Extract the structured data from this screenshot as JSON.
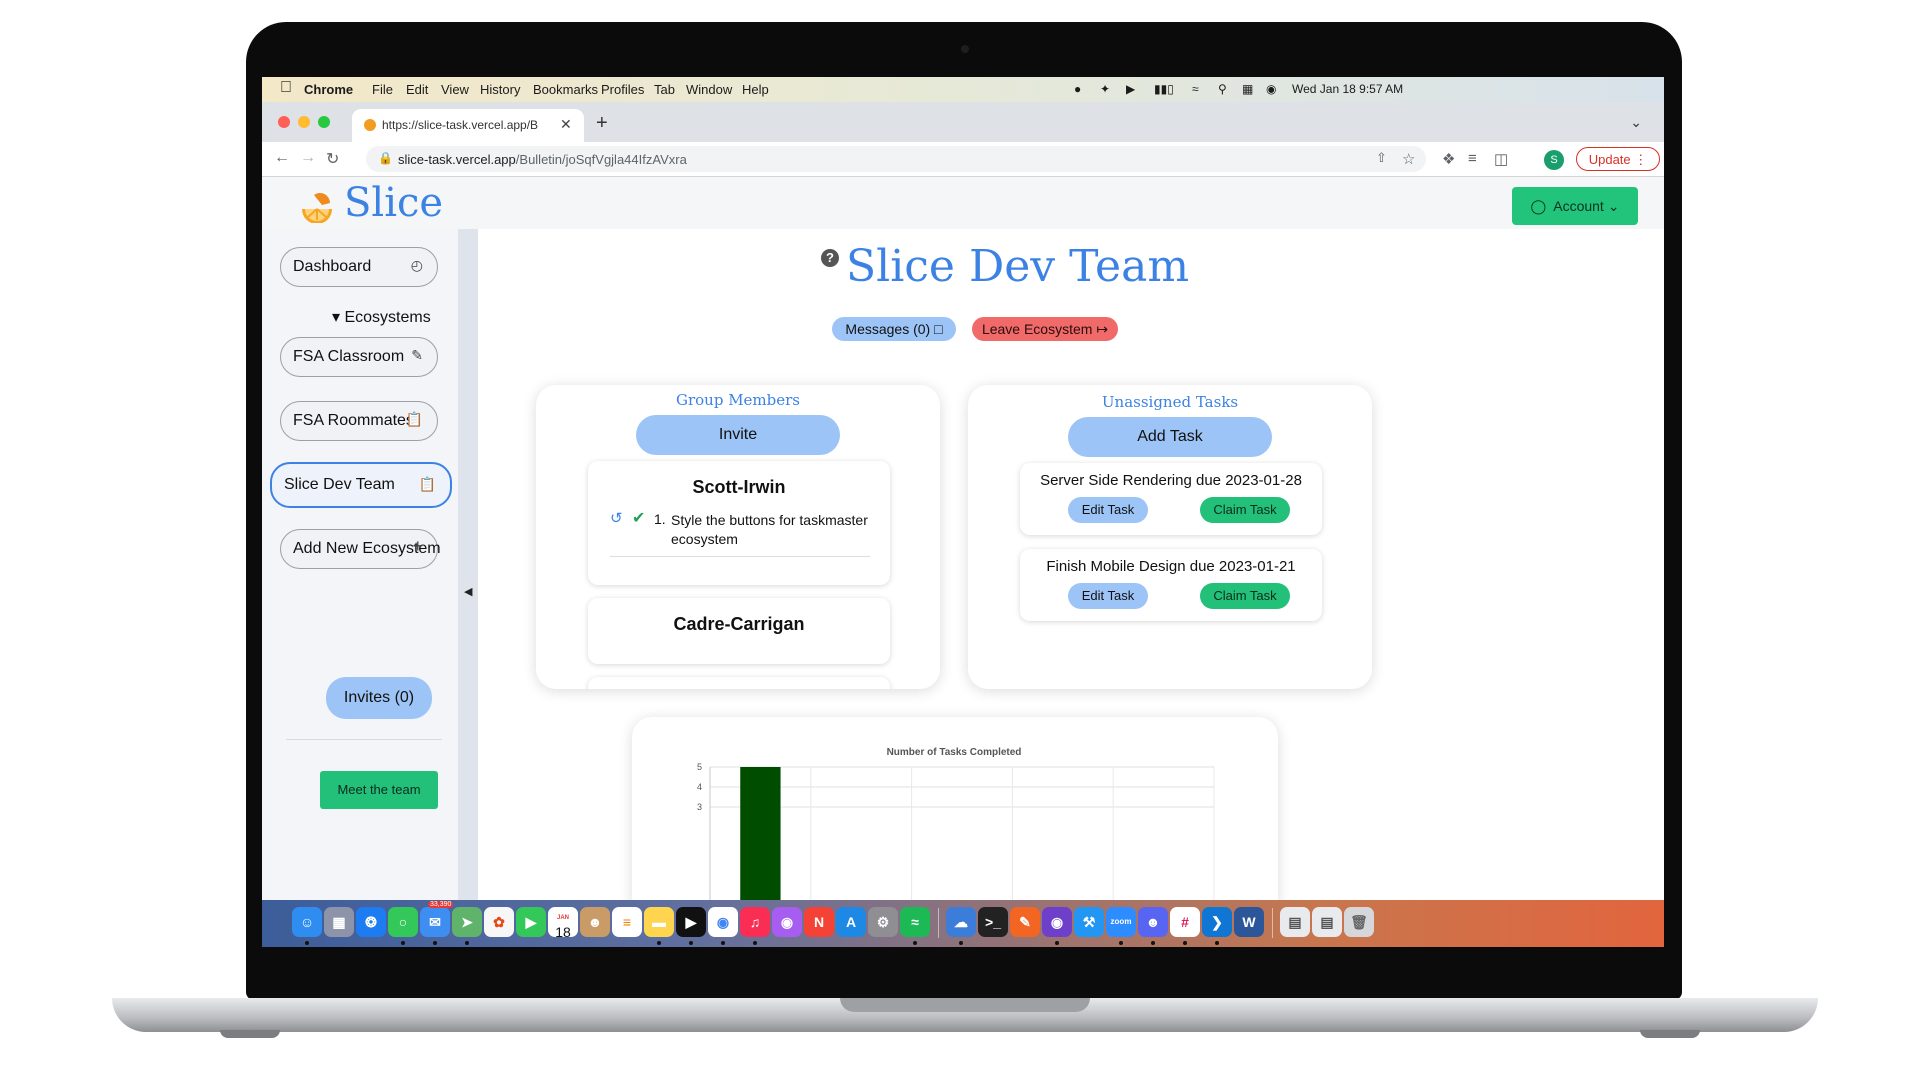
{
  "menubar": {
    "app": "Chrome",
    "menus": [
      "File",
      "Edit",
      "View",
      "History",
      "Bookmarks",
      "Profiles",
      "Tab",
      "Window",
      "Help"
    ],
    "clock": "Wed Jan 18  9:57 AM"
  },
  "browser": {
    "tab_title": "https://slice-task.vercel.app/B",
    "url_domain": "slice-task.vercel.app",
    "url_path": "/Bulletin/joSqfVgjla44IfzAVxra",
    "profile_initial": "S",
    "update_label": "Update"
  },
  "header": {
    "brand": "Slice",
    "account_label": "Account"
  },
  "sidebar": {
    "dashboard": "Dashboard",
    "ecosystems_label": "Ecosystems",
    "ecosystems": [
      "FSA Classroom",
      "FSA Roommates",
      "Slice Dev Team"
    ],
    "active_ecosystem": "Slice Dev Team",
    "add_ecosystem": "Add New Ecosystem",
    "invites": "Invites (0)",
    "meet_team": "Meet the team"
  },
  "main": {
    "title": "Slice Dev Team",
    "messages_label": "Messages (0)",
    "leave_label": "Leave Ecosystem",
    "group_members": {
      "title": "Group Members",
      "invite_label": "Invite",
      "members": [
        {
          "name": "Scott-Irwin",
          "tasks": [
            {
              "num": "1.",
              "text": "Style the buttons for taskmaster ecosystem"
            }
          ]
        },
        {
          "name": "Cadre-Carrigan",
          "tasks": []
        }
      ]
    },
    "unassigned_tasks": {
      "title": "Unassigned Tasks",
      "add_label": "Add Task",
      "edit_label": "Edit Task",
      "claim_label": "Claim Task",
      "tasks": [
        {
          "title": "Server Side Rendering due 2023-01-28"
        },
        {
          "title": "Finish Mobile Design due 2023-01-21"
        }
      ]
    }
  },
  "chart_data": {
    "type": "bar",
    "title": "Number of Tasks Completed",
    "y_ticks": [
      "5",
      "4",
      "3"
    ],
    "ylim": [
      0,
      5
    ],
    "values_visible": [
      5
    ],
    "bar_color": "#004d00"
  },
  "dock": {
    "mail_badge": "33,390",
    "calendar_day": "18",
    "calendar_month": "JAN"
  }
}
